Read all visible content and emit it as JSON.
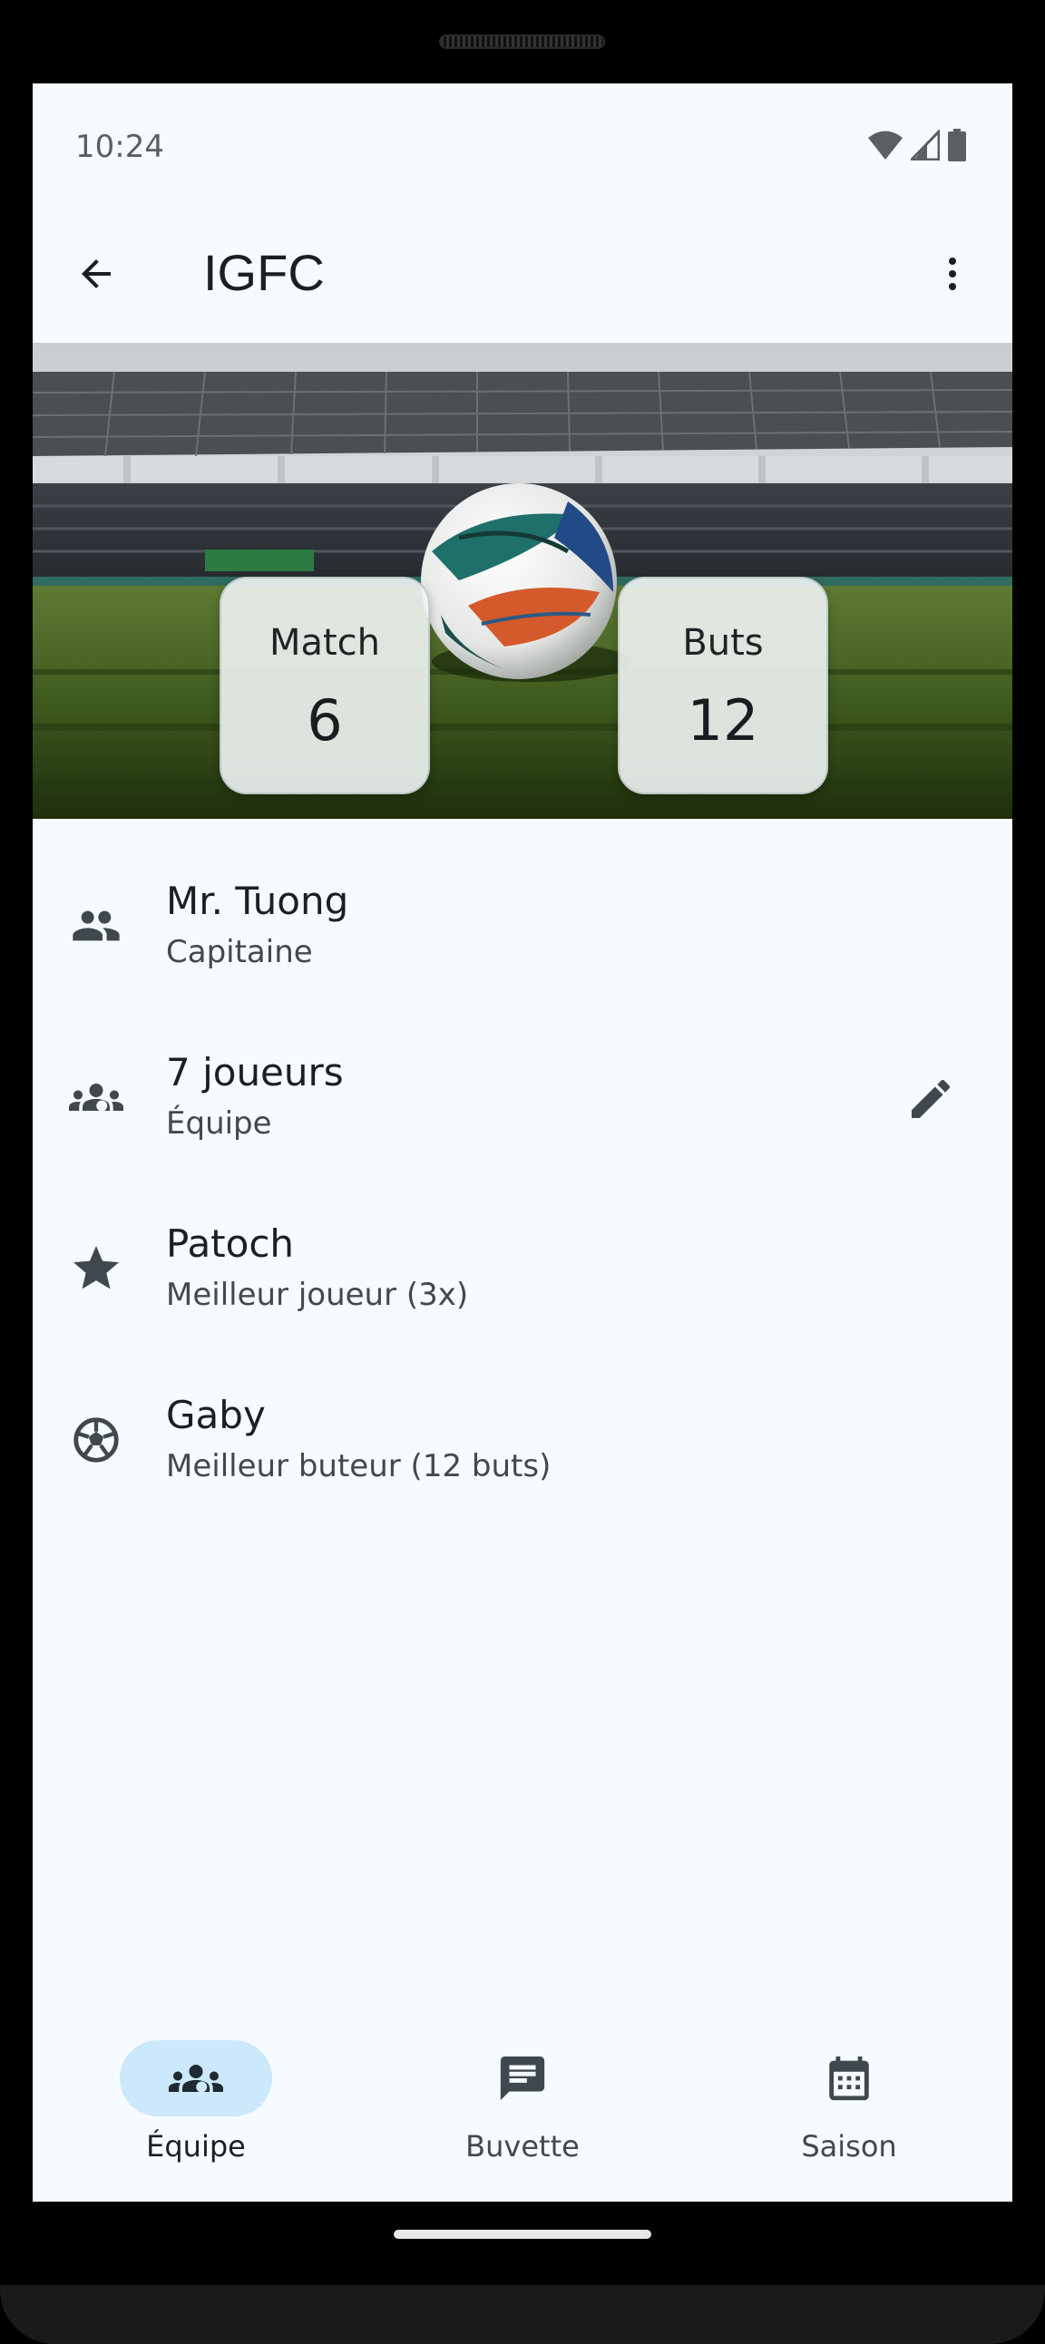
{
  "status_bar": {
    "time": "10:24",
    "icons": [
      "wifi-icon",
      "cell-signal-icon",
      "battery-icon"
    ]
  },
  "app_bar": {
    "title": "IGFC",
    "back_icon": "arrow-back-icon",
    "menu_icon": "more-vert-icon"
  },
  "hero": {
    "stats": [
      {
        "label": "Match",
        "value": "6"
      },
      {
        "label": "Buts",
        "value": "12"
      }
    ]
  },
  "list": {
    "items": [
      {
        "title": "Mr. Tuong",
        "subtitle": "Capitaine",
        "icon": "people-icon"
      },
      {
        "title": "7 joueurs",
        "subtitle": "Équipe",
        "icon": "groups-icon",
        "action_icon": "edit-icon"
      },
      {
        "title": "Patoch",
        "subtitle": "Meilleur joueur (3x)",
        "icon": "star-icon"
      },
      {
        "title": "Gaby",
        "subtitle": "Meilleur buteur (12 buts)",
        "icon": "soccer-ball-icon"
      }
    ]
  },
  "bottom_nav": {
    "items": [
      {
        "label": "Équipe",
        "icon": "groups-icon",
        "active": true
      },
      {
        "label": "Buvette",
        "icon": "chat-icon",
        "active": false
      },
      {
        "label": "Saison",
        "icon": "calendar-icon",
        "active": false
      }
    ]
  },
  "colors": {
    "background": "#f6fbff",
    "icon": "#3f484e",
    "active_pill": "#cce8fb",
    "text_primary": "#1b1f23",
    "text_secondary": "#42484c"
  }
}
